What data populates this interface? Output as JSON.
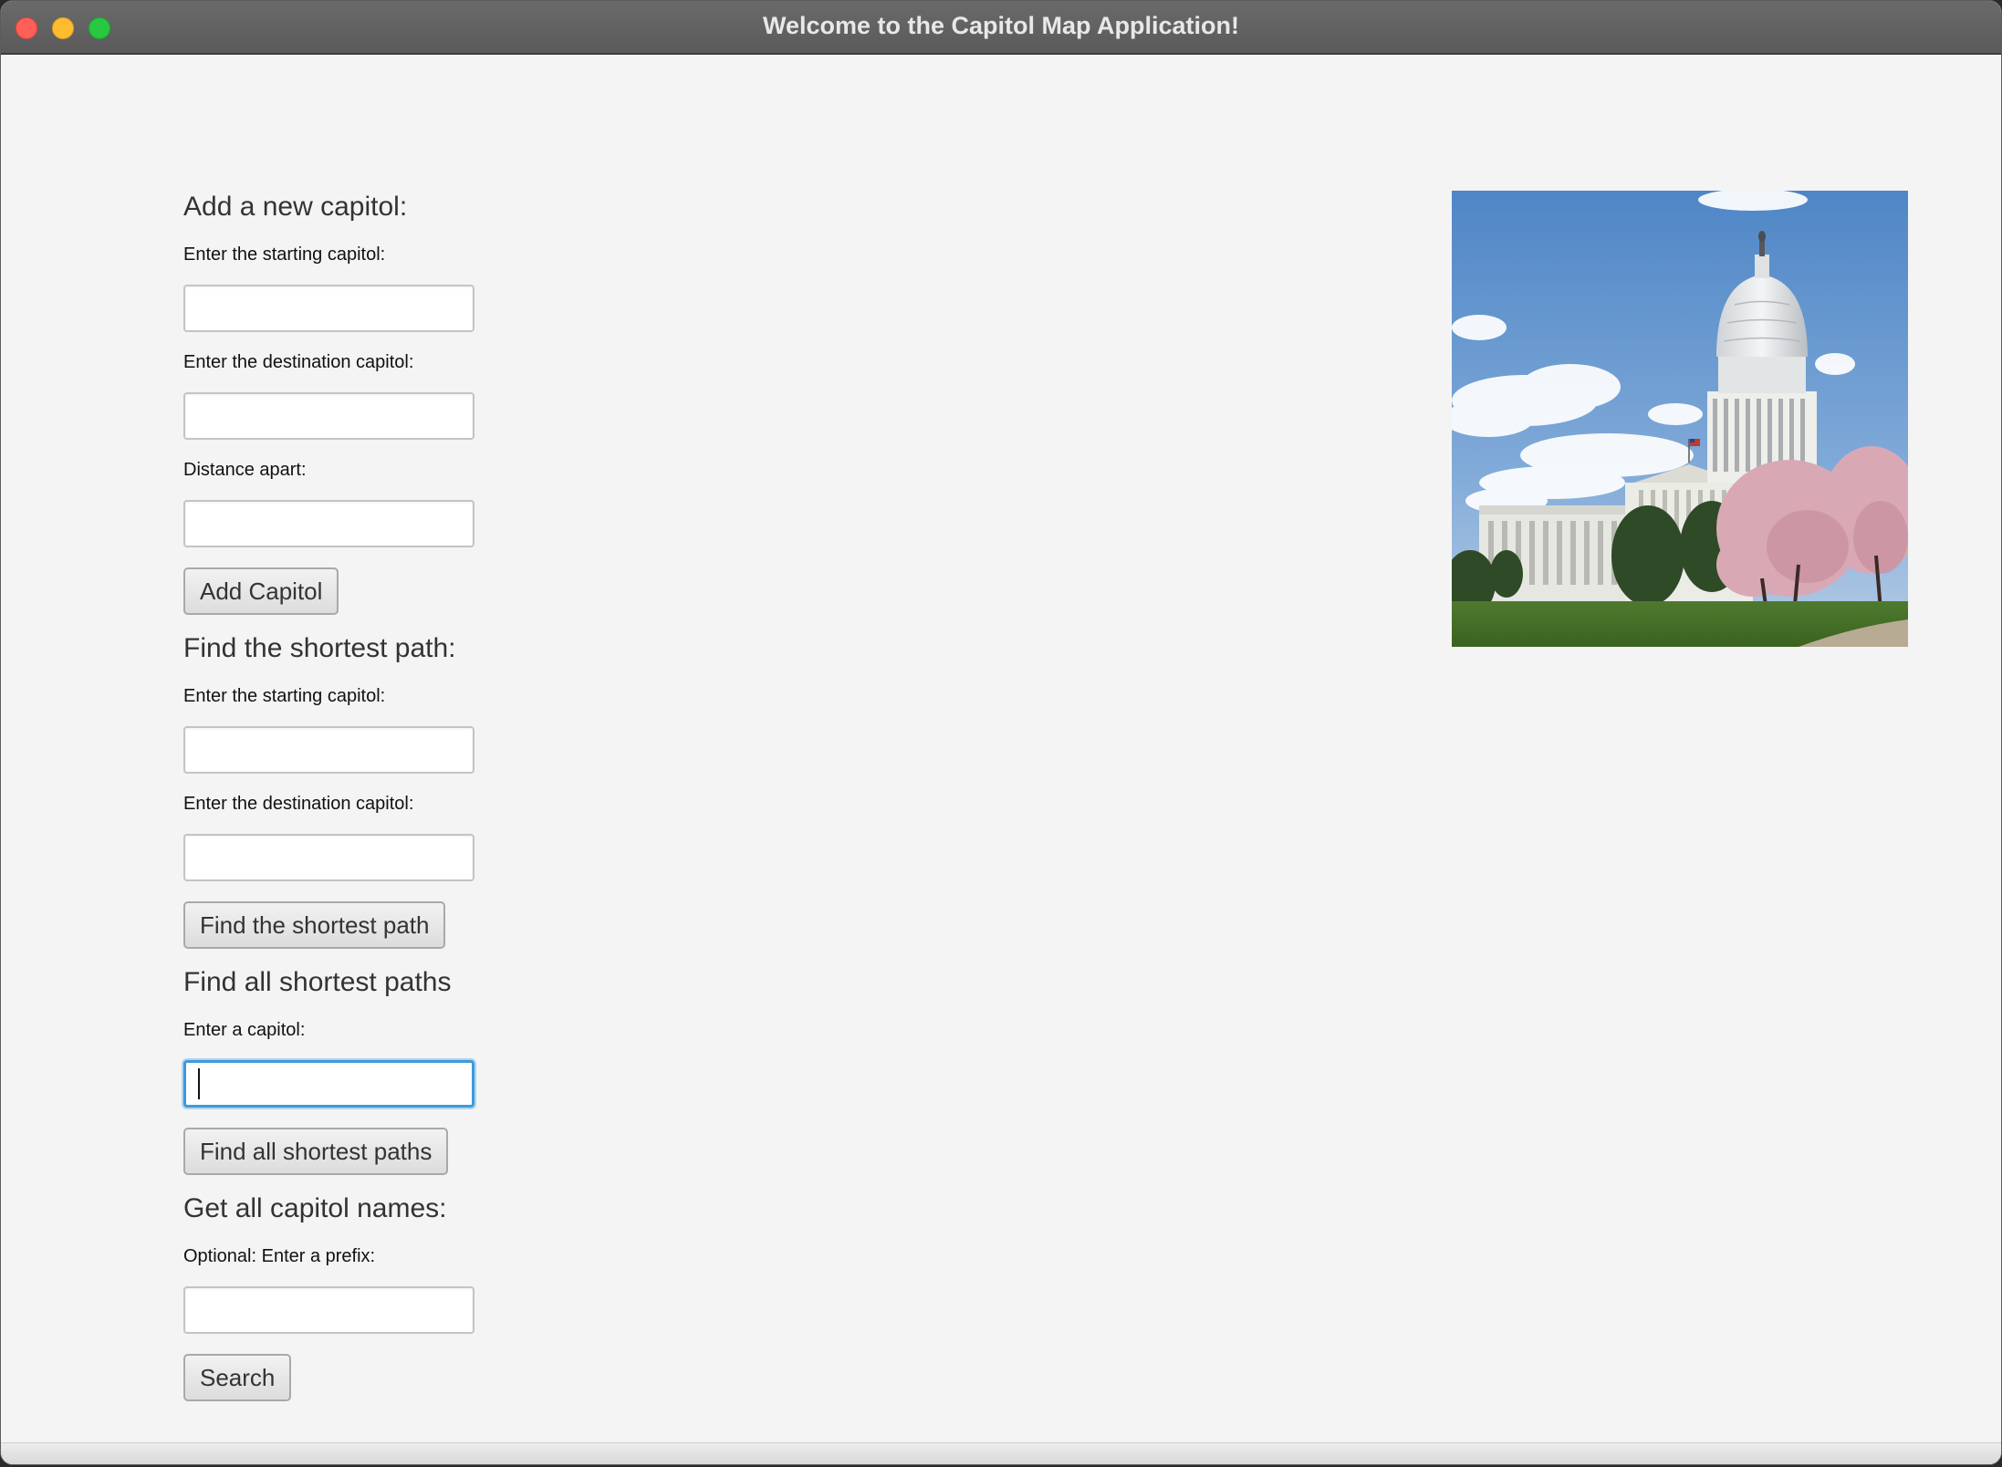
{
  "window": {
    "title": "Welcome to the Capitol Map Application!"
  },
  "add_capitol": {
    "heading": "Add a new capitol:",
    "start_label": "Enter the starting capitol:",
    "start_value": "",
    "dest_label": "Enter the destination capitol:",
    "dest_value": "",
    "distance_label": "Distance apart:",
    "distance_value": "",
    "button_label": "Add Capitol"
  },
  "shortest_path": {
    "heading": "Find the shortest path:",
    "start_label": "Enter the starting capitol:",
    "start_value": "",
    "dest_label": "Enter the destination capitol:",
    "dest_value": "",
    "button_label": "Find the shortest path"
  },
  "all_paths": {
    "heading": "Find all shortest paths",
    "capitol_label": "Enter a capitol:",
    "capitol_value": "",
    "button_label": "Find all shortest paths"
  },
  "capitol_names": {
    "heading": "Get all capitol names:",
    "prefix_label": "Optional: Enter a prefix:",
    "prefix_value": "",
    "button_label": "Search"
  },
  "colors": {
    "focus_ring": "#3d9bd9",
    "window_bg": "#f4f4f4",
    "titlebar": "#5f5f5f"
  }
}
